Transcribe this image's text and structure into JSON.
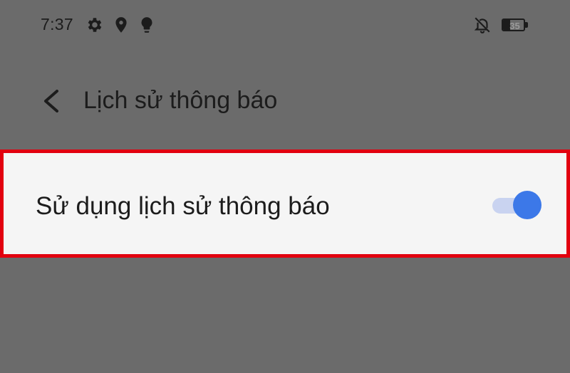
{
  "status_bar": {
    "time": "7:37",
    "battery_level": "35",
    "icons": [
      "gear-icon",
      "location-pin-icon",
      "lightbulb-icon",
      "bell-off-icon",
      "battery-icon"
    ]
  },
  "header": {
    "title": "Lịch sử thông báo",
    "back_icon": "chevron-left-icon"
  },
  "setting": {
    "label": "Sử dụng lịch sử thông báo",
    "toggle_on": true
  },
  "colors": {
    "background": "#6b6b6b",
    "row_background": "#f5f5f5",
    "highlight_border": "#e2000f",
    "toggle_knob": "#3c78e8",
    "toggle_track": "#c9d3f0",
    "text": "#1c1c1c"
  }
}
